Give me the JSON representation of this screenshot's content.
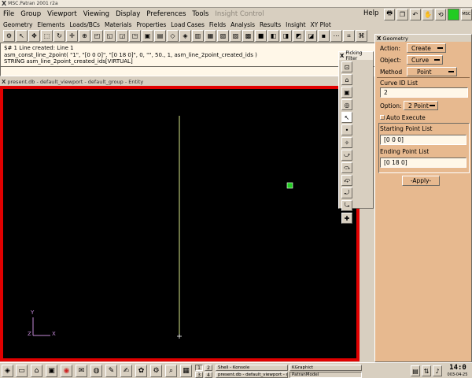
{
  "window": {
    "title": "MSC.Patran 2001 r2a"
  },
  "menu": [
    {
      "label": "File",
      "enabled": true
    },
    {
      "label": "Group",
      "enabled": true
    },
    {
      "label": "Viewport",
      "enabled": true
    },
    {
      "label": "Viewing",
      "enabled": true
    },
    {
      "label": "Display",
      "enabled": true
    },
    {
      "label": "Preferences",
      "enabled": true
    },
    {
      "label": "Tools",
      "enabled": true
    },
    {
      "label": "Insight Control",
      "enabled": false
    }
  ],
  "help_label": "Help",
  "app_buttons": [
    "Geometry",
    "Elements",
    "Loads/BCs",
    "Materials",
    "Properties",
    "Load Cases",
    "Fields",
    "Analysis",
    "Results",
    "Insight",
    "XY Plot"
  ],
  "history": [
    "$# 1 Line created: Line 1",
    "asm_const_line_2point( \"1\", \"[0 0 0]\", \"[0 18 0]\", 0, \"\", 50., 1, asm_line_2point_created_ids )",
    "STRING asm_line_2point_created_ids[VIRTUAL]"
  ],
  "viewport": {
    "title": "present.db - default_viewport - default_group - Entity",
    "axis_x": "X",
    "axis_y": "Y",
    "axis_z": "Z"
  },
  "picking": {
    "title": "Picking Filter"
  },
  "geometry": {
    "title": "Geometry",
    "action_label": "Action:",
    "action_value": "Create",
    "object_label": "Object:",
    "object_value": "Curve",
    "method_label": "Method",
    "method_value": "Point",
    "curve_id_label": "Curve ID List",
    "curve_id_value": "2",
    "option_label": "Option:",
    "option_value": "2 Point",
    "auto_execute_label": "Auto Execute",
    "starting_point_label": "Starting Point List",
    "starting_point_value": "[0 0 0]",
    "ending_point_label": "Ending Point List",
    "ending_point_value": "[0 18 0]",
    "apply_label": "-Apply-"
  },
  "taskbar": {
    "tasks": [
      "Shell - Konsole",
      "KGraphict",
      "present.db - default_viewport - d",
      "PatranModel"
    ],
    "desktops": [
      "1",
      "2",
      "3",
      "4"
    ],
    "clock": "14:0",
    "date": "003-04-25"
  },
  "colors": {
    "viewport_border": "#e10000",
    "panel_bg": "#e7b98f",
    "history_bg": "#fff7e8",
    "line": "#d8e88a",
    "marker": "#22cc22"
  }
}
